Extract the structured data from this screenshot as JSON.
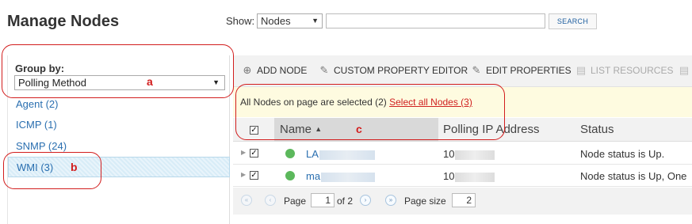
{
  "header": {
    "title": "Manage Nodes",
    "show_label": "Show:",
    "show_value": "Nodes",
    "search_placeholder": "",
    "search_button": "SEARCH"
  },
  "left_panel": {
    "group_by_label": "Group by:",
    "group_by_value": "Polling Method",
    "groups": [
      {
        "label": "Agent (2)"
      },
      {
        "label": "ICMP (1)"
      },
      {
        "label": "SNMP (24)"
      },
      {
        "label": "WMI (3)",
        "selected": true
      }
    ]
  },
  "toolbar": {
    "add_node": "ADD NODE",
    "custom_property_editor": "CUSTOM PROPERTY EDITOR",
    "edit_properties": "EDIT PROPERTIES",
    "list_resources": "LIST RESOURCES"
  },
  "selection_banner": {
    "text": "All Nodes on page are selected (2)",
    "link": "Select all Nodes (3)"
  },
  "grid": {
    "columns": {
      "name": "Name",
      "polling_ip": "Polling IP Address",
      "status": "Status"
    },
    "rows": [
      {
        "name": "LA",
        "ip": "10",
        "status": "Node status is Up."
      },
      {
        "name": "ma",
        "ip": "10",
        "status": "Node status is Up, One"
      }
    ]
  },
  "pager": {
    "page_label": "Page",
    "page_value": "1",
    "of_label": "of 2",
    "page_size_label": "Page size",
    "page_size_value": "2"
  },
  "annotations": {
    "a": "a",
    "b": "b",
    "c": "c",
    "color": "#d21d1d"
  },
  "colors": {
    "link_blue": "#2a6fb0",
    "status_up_green": "#5cb85c",
    "banner_yellow": "#fefbe0"
  }
}
